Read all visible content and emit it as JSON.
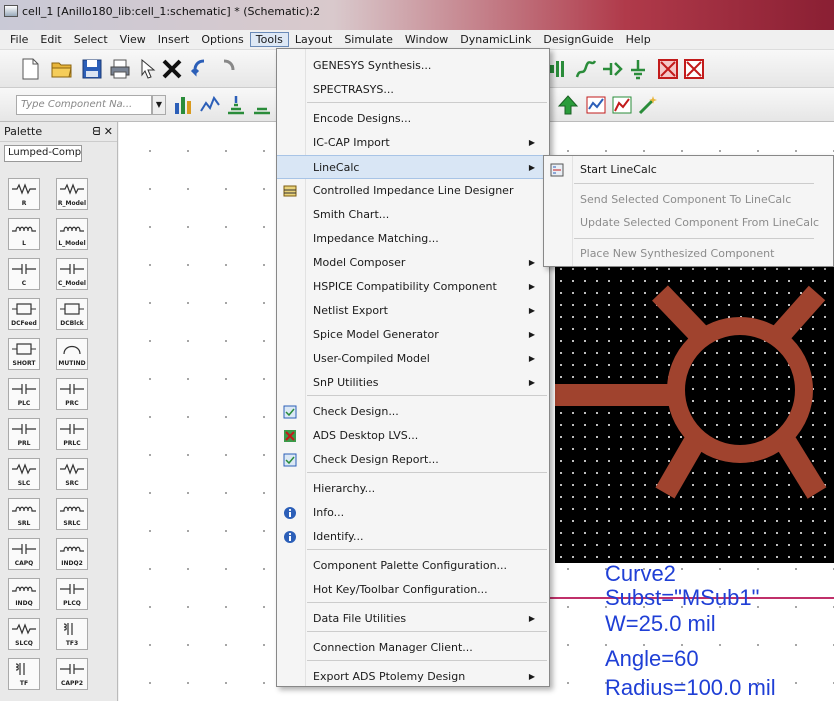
{
  "window": {
    "title": "cell_1 [Anillo180_lib:cell_1:schematic] * (Schematic):2"
  },
  "menubar": [
    "File",
    "Edit",
    "Select",
    "View",
    "Insert",
    "Options",
    "Tools",
    "Layout",
    "Simulate",
    "Window",
    "DynamicLink",
    "DesignGuide",
    "Help"
  ],
  "toolbar": {
    "component_search_placeholder": "Type Component Na..."
  },
  "palette": {
    "title": "Palette",
    "pin_symbol": "ᗺ",
    "close_symbol": "✕",
    "category": "Lumped-Compone ▾",
    "items": [
      "R",
      "R_Model",
      "L",
      "L_Model",
      "C",
      "C_Model",
      "DCFeed",
      "DCBlck",
      "SHORT",
      "MUTIND",
      "PLC",
      "PRC",
      "PRL",
      "PRLC",
      "SLC",
      "SRC",
      "SRL",
      "SRLC",
      "CAPQ",
      "INDQ2",
      "INDQ",
      "PLCQ",
      "SLCQ",
      "TF3",
      "TF",
      "CAPP2"
    ]
  },
  "tools_menu": {
    "items": [
      {
        "label": "GENESYS Synthesis...",
        "submenu": false
      },
      {
        "label": "SPECTRASYS...",
        "submenu": false
      },
      {
        "label": "Encode Designs...",
        "submenu": false
      },
      {
        "label": "IC-CAP Import",
        "submenu": true
      },
      {
        "label": "LineCalc",
        "submenu": true
      },
      {
        "label": "Controlled Impedance Line Designer",
        "submenu": false
      },
      {
        "label": "Smith Chart...",
        "submenu": false
      },
      {
        "label": "Impedance Matching...",
        "submenu": false
      },
      {
        "label": "Model Composer",
        "submenu": true
      },
      {
        "label": "HSPICE Compatibility Component",
        "submenu": true
      },
      {
        "label": "Netlist Export",
        "submenu": true
      },
      {
        "label": "Spice Model Generator",
        "submenu": true
      },
      {
        "label": "User-Compiled Model",
        "submenu": true
      },
      {
        "label": "SnP Utilities",
        "submenu": true
      },
      {
        "label": "Check Design...",
        "submenu": false
      },
      {
        "label": "ADS Desktop LVS...",
        "submenu": false
      },
      {
        "label": "Check Design Report...",
        "submenu": false
      },
      {
        "label": "Hierarchy...",
        "submenu": false
      },
      {
        "label": "Info...",
        "submenu": false
      },
      {
        "label": "Identify...",
        "submenu": false
      },
      {
        "label": "Component Palette Configuration...",
        "submenu": false
      },
      {
        "label": "Hot Key/Toolbar Configuration...",
        "submenu": false
      },
      {
        "label": "Data File Utilities",
        "submenu": true
      },
      {
        "label": "Connection Manager Client...",
        "submenu": false
      },
      {
        "label": "Export ADS Ptolemy Design",
        "submenu": true
      }
    ]
  },
  "linecalc_submenu": {
    "items": [
      {
        "label": "Start LineCalc",
        "enabled": true
      },
      {
        "label": "Send Selected Component To LineCalc",
        "enabled": false
      },
      {
        "label": "Update Selected Component From LineCalc",
        "enabled": false
      },
      {
        "label": "Place New Synthesized Component",
        "enabled": false
      }
    ]
  },
  "component_props": {
    "name": "Curve2",
    "subst": "Subst=\"MSub1\"",
    "width": "W=25.0 mil",
    "angle": "Angle=60",
    "radius": "Radius=100.0 mil"
  },
  "colors": {
    "trace": "#a0432e",
    "text_blue": "#1f3fd6",
    "wire": "#c0306a",
    "menu_highlight": "#d9e6f5"
  }
}
